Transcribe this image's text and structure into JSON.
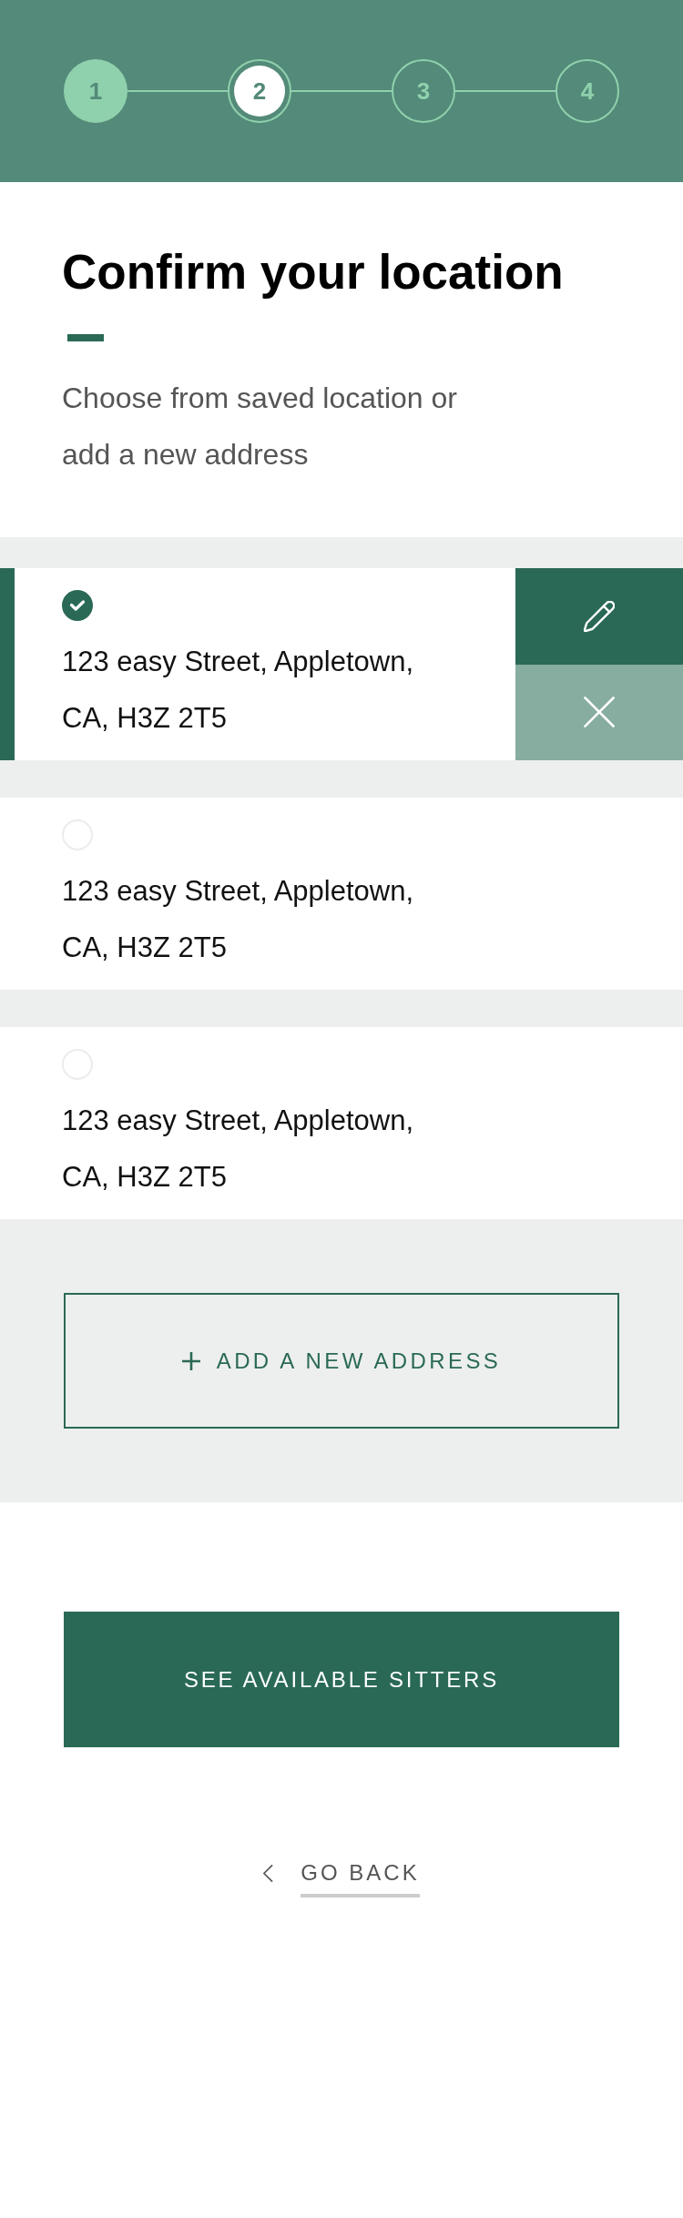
{
  "stepper": {
    "steps": [
      {
        "label": "1",
        "completed": true,
        "selected": false
      },
      {
        "label": "2",
        "completed": false,
        "selected": true
      },
      {
        "label": "3",
        "completed": false,
        "selected": false
      },
      {
        "label": "4",
        "completed": false,
        "selected": false
      }
    ]
  },
  "heading": {
    "title": "Confirm your location",
    "subtitle": "Choose from saved location or add a new address"
  },
  "addresses": [
    {
      "address": "123 easy Street, Appletown, CA, H3Z 2T5",
      "selected": true,
      "actions_shown": true
    },
    {
      "address": "123 easy Street, Appletown, CA, H3Z 2T5",
      "selected": false,
      "actions_shown": false
    },
    {
      "address": "123 easy Street, Appletown, CA, H3Z 2T5",
      "selected": false,
      "actions_shown": false
    }
  ],
  "add_button": {
    "label": "ADD A NEW ADDRESS"
  },
  "primary_button": {
    "label": "SEE AVAILABLE SITTERS"
  },
  "back_link": {
    "label": "GO BACK"
  }
}
